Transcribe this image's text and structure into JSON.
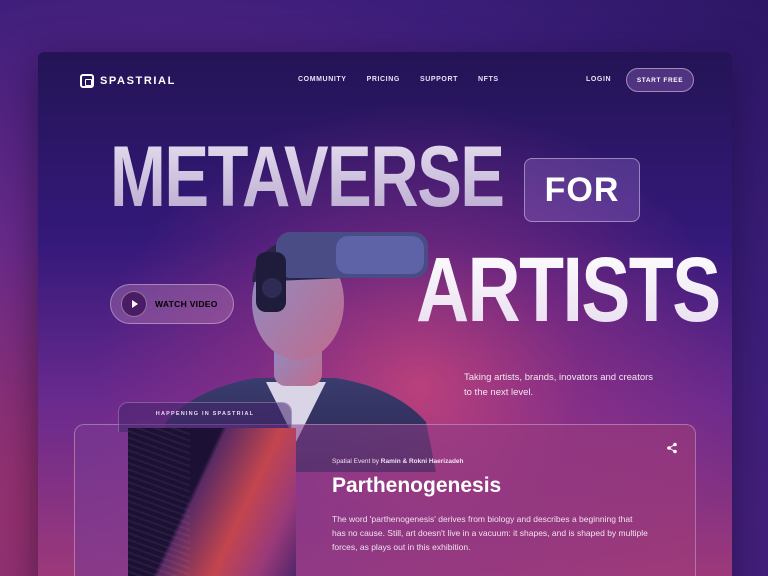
{
  "brand": {
    "name": "SPASTRIAL"
  },
  "nav": {
    "items": [
      "COMMUNITY",
      "PRICING",
      "SUPPORT",
      "NFTS"
    ],
    "login": "LOGIN",
    "cta": "START FREE"
  },
  "hero": {
    "line1": "METAVERSE",
    "line2_box": "FOR",
    "line3": "ARTISTS",
    "watch_label": "WATCH VIDEO",
    "tagline": "Taking artists, brands, inovators and creators  to the next level."
  },
  "event": {
    "tab_label": "HAPPENING IN SPASTRIAL",
    "meta_prefix": "Spatial Event by",
    "meta_authors": "Ramin & Rokni Haerizadeh",
    "title": "Parthenogenesis",
    "description": "The word 'parthenogenesis' derives from biology and describes a beginning that has no cause. Still, art doesn't live in a vacuum: it shapes, and is shaped by multiple forces, as plays out in this exhibition."
  },
  "icons": {
    "play": "play-icon",
    "share": "share-icon",
    "logo": "logo-icon"
  }
}
